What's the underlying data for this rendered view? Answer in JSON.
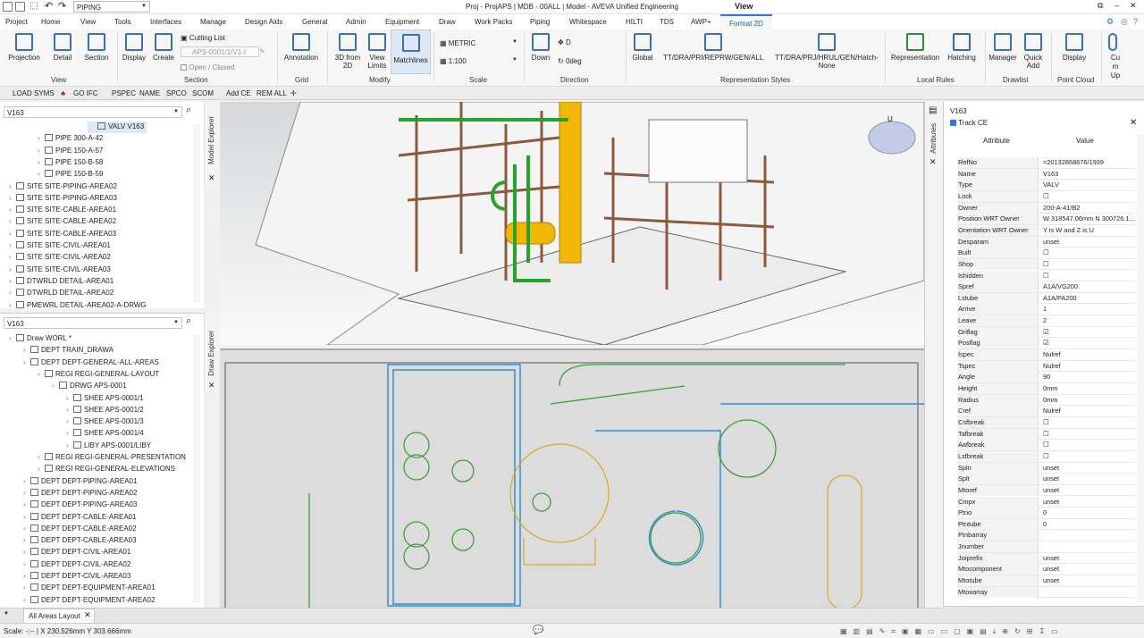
{
  "app": {
    "title": "Proj - ProjAPS | MDB - 00ALL | Model - AVEVA Unified Engineering",
    "view_label": "View",
    "discipline": "PIPING"
  },
  "menu": [
    "Project",
    "Home",
    "View",
    "Tools",
    "Interfaces",
    "Manage",
    "Design Aids",
    "General",
    "Admin",
    "Equipment",
    "Draw",
    "Work Packs",
    "Piping",
    "Whitespace",
    "HILTI",
    "TDS",
    "AWP+",
    "Format 2D"
  ],
  "ribbon": {
    "projection": "Projection",
    "detail": "Detail",
    "section": "Section",
    "display": "Display",
    "create": "Create",
    "cutting_list": "Cutting List",
    "cutting_value": "APS-0001/1/V1-I",
    "open_closed": "Open / Closed",
    "annotation": "Annotation",
    "three_d_from": "3D from 2D",
    "view_limits": "View Limits",
    "matchlines": "Matchlines",
    "metric": "METRIC",
    "scale_val": "1:100",
    "down": "Down",
    "d_label": "D",
    "deg": "0deg",
    "global": "Global",
    "rep1": "TT/DRA/PRI/REPRW/GEN/ALL",
    "rep2": "TT/DRA/PRJ/HRUL/GEN/Hatch-",
    "rep2b": "None",
    "representation": "Representation",
    "hatching": "Hatching",
    "manager": "Manager",
    "quick_add": "Quick Add",
    "display2": "Display",
    "cut": "Cu",
    "m": "m",
    "up": "Up",
    "groups": {
      "view": "View",
      "section": "Section",
      "grid": "Grid",
      "modify": "Modify",
      "scale": "Scale",
      "direction": "Direction",
      "rep_styles": "Representation Styles",
      "local_rules": "Local Rules",
      "drawlist": "Drawlist",
      "point_cloud": "Point Cloud"
    }
  },
  "cmdbar": [
    "LOAD SYMS",
    "GO IFC",
    "PSPEC",
    "NAME",
    "SPCO",
    "SCOM",
    "Add CE",
    "REM ALL"
  ],
  "model_explorer": {
    "search": "V163",
    "tab": "Model Explorer",
    "items": [
      {
        "label": "VALV V163",
        "indent": 1,
        "selected": true
      },
      {
        "label": "PIPE 300-A-42",
        "indent": 2
      },
      {
        "label": "PIPE 150-A-57",
        "indent": 2
      },
      {
        "label": "PIPE 150-B-58",
        "indent": 2
      },
      {
        "label": "PIPE 150-B-59",
        "indent": 2
      },
      {
        "label": "SITE SITE-PIPING-AREA02",
        "indent": 0
      },
      {
        "label": "SITE SITE-PIPING-AREA03",
        "indent": 0
      },
      {
        "label": "SITE SITE-CABLE-AREA01",
        "indent": 0
      },
      {
        "label": "SITE SITE-CABLE-AREA02",
        "indent": 0
      },
      {
        "label": "SITE SITE-CABLE-AREA03",
        "indent": 0
      },
      {
        "label": "SITE SITE-CIVIL-AREA01",
        "indent": 0
      },
      {
        "label": "SITE SITE-CIVIL-AREA02",
        "indent": 0
      },
      {
        "label": "SITE SITE-CIVIL-AREA03",
        "indent": 0
      },
      {
        "label": "DTWRLD DETAIL-AREA01",
        "indent": 0
      },
      {
        "label": "DTWRLD DETAIL-AREA02",
        "indent": 0
      },
      {
        "label": "PMEWRL DETAIL-AREA02-A-DRWG",
        "indent": 0
      }
    ]
  },
  "draw_explorer": {
    "search": "V163",
    "tab": "Draw Explorer",
    "items": [
      {
        "label": "Draw WORL *",
        "indent": 0
      },
      {
        "label": "DEPT TRAIN_DRAWA",
        "indent": 1
      },
      {
        "label": "DEPT DEPT-GENERAL-ALL-AREAS",
        "indent": 1
      },
      {
        "label": "REGI REGI-GENERAL-LAYOUT",
        "indent": 2
      },
      {
        "label": "DRWG APS-0001",
        "indent": 3
      },
      {
        "label": "SHEE APS-0001/1",
        "indent": 4
      },
      {
        "label": "SHEE APS-0001/2",
        "indent": 4
      },
      {
        "label": "SHEE APS-0001/3",
        "indent": 4
      },
      {
        "label": "SHEE APS-0001/4",
        "indent": 4
      },
      {
        "label": "LIBY APS-0001/LIBY",
        "indent": 4
      },
      {
        "label": "REGI REGI-GENERAL-PRESENTATION",
        "indent": 2
      },
      {
        "label": "REGI REGI-GENERAL-ELEVATIONS",
        "indent": 2
      },
      {
        "label": "DEPT DEPT-PIPING-AREA01",
        "indent": 1
      },
      {
        "label": "DEPT DEPT-PIPING-AREA02",
        "indent": 1
      },
      {
        "label": "DEPT DEPT-PIPING-AREA03",
        "indent": 1
      },
      {
        "label": "DEPT DEPT-CABLE-AREA01",
        "indent": 1
      },
      {
        "label": "DEPT DEPT-CABLE-AREA02",
        "indent": 1
      },
      {
        "label": "DEPT DEPT-CABLE-AREA03",
        "indent": 1
      },
      {
        "label": "DEPT DEPT-CIVIL-AREA01",
        "indent": 1
      },
      {
        "label": "DEPT DEPT-CIVIL-AREA02",
        "indent": 1
      },
      {
        "label": "DEPT DEPT-CIVIL-AREA03",
        "indent": 1
      },
      {
        "label": "DEPT DEPT-EQUIPMENT-AREA01",
        "indent": 1
      },
      {
        "label": "DEPT DEPT-EQUIPMENT-AREA02",
        "indent": 1
      }
    ]
  },
  "attributes": {
    "ce": "V163",
    "track": "Track CE",
    "tab": "Attributes",
    "col_attr": "Attribute",
    "col_val": "Value",
    "rows": [
      [
        "RefNo",
        "=20132868676/1939"
      ],
      [
        "Name",
        "V163"
      ],
      [
        "Type",
        "VALV"
      ],
      [
        "Lock",
        "☐"
      ],
      [
        "Owner",
        "200-A-41/B2"
      ],
      [
        "Position WRT Owner",
        "W 318547.06mm N 300726.1..."
      ],
      [
        "Orientation WRT Owner",
        "Y is W and Z is U"
      ],
      [
        "Desparam",
        "unset"
      ],
      [
        "Built",
        "☐"
      ],
      [
        "Shop",
        "☐"
      ],
      [
        "Ishidden",
        "☐"
      ],
      [
        "Spref",
        "A1A/VG200"
      ],
      [
        "Lstube",
        "A1A/PA200"
      ],
      [
        "Arrive",
        "1"
      ],
      [
        "Leave",
        "2"
      ],
      [
        "Oriflag",
        "☑"
      ],
      [
        "Posflag",
        "☑"
      ],
      [
        "Ispec",
        "Nulref"
      ],
      [
        "Tspec",
        "Nulref"
      ],
      [
        "Angle",
        "90"
      ],
      [
        "Height",
        "0mm"
      ],
      [
        "Radius",
        "0mm"
      ],
      [
        "Cref",
        "Nulref"
      ],
      [
        "Csfbreak",
        "☐"
      ],
      [
        "Tafbreak",
        "☐"
      ],
      [
        "Aafbreak",
        "☐"
      ],
      [
        "Lsfbreak",
        "☐"
      ],
      [
        "Spln",
        "unset"
      ],
      [
        "Splt",
        "unset"
      ],
      [
        "Mtoref",
        "unset"
      ],
      [
        "Cmpx",
        "unset"
      ],
      [
        "Ptno",
        "0"
      ],
      [
        "Ptntube",
        "0"
      ],
      [
        "Ptnbarray",
        ""
      ],
      [
        "Jnumber",
        ""
      ],
      [
        "Joiprefix",
        "unset"
      ],
      [
        "Mtocomponent",
        "unset"
      ],
      [
        "Mtotube",
        "unset"
      ],
      [
        "Mtoxarray",
        ""
      ]
    ]
  },
  "bottom_tab": "All Areas Layout",
  "status": "Scale: -:-- | X 230.526mm Y 303.666mm"
}
